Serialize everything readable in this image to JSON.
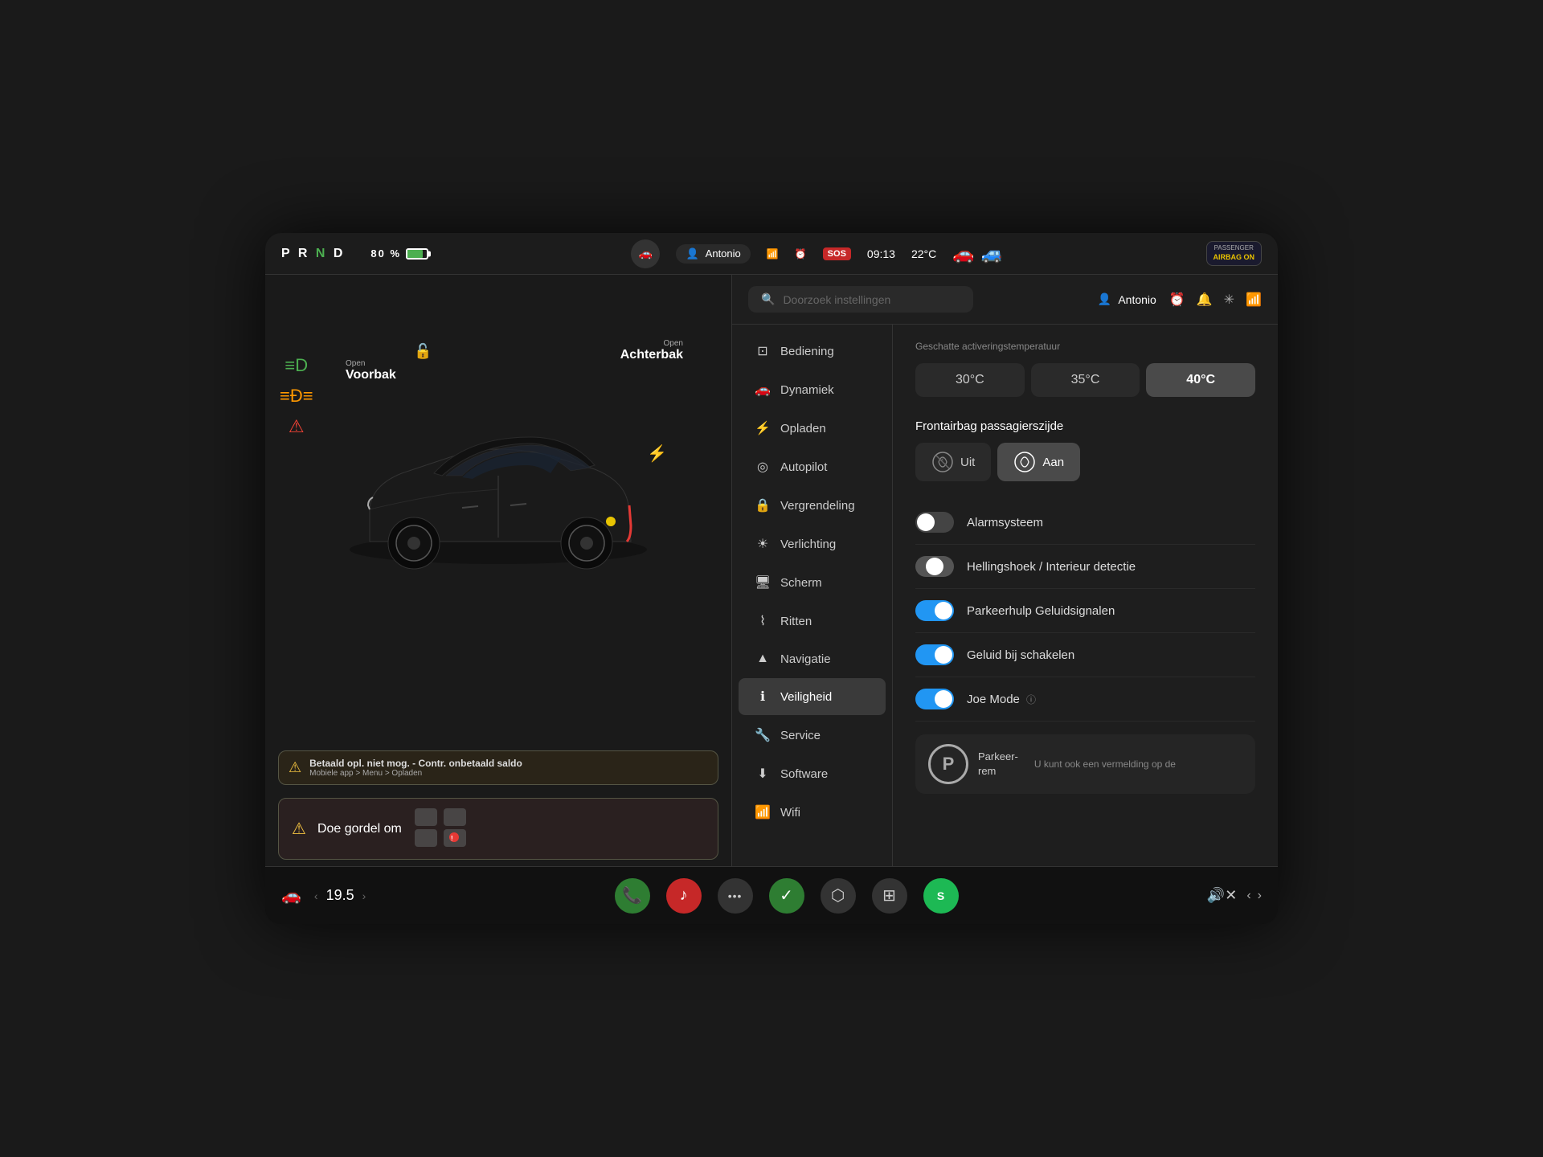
{
  "statusBar": {
    "prnd": "PRND",
    "battery_pct": "80 %",
    "user": "Antonio",
    "wifi_icon": "📶",
    "alarm_icon": "⏰",
    "sos": "SOS",
    "time": "09:13",
    "temperature": "22°C",
    "airbag_title": "PASSENGER",
    "airbag_sub": "AIRBAG ON"
  },
  "indicators": [
    {
      "icon": "≡D",
      "class": "green"
    },
    {
      "icon": "≡D≡",
      "class": "amber"
    },
    {
      "icon": "⚠",
      "class": "red"
    }
  ],
  "carLabels": {
    "voorbak_open": "Open",
    "voorbak": "Voorbak",
    "achterbak_open": "Open",
    "achterbak": "Achterbak"
  },
  "warningBanner": {
    "text": "Betaald opl. niet mog. - Contr. onbetaald saldo",
    "subtext": "Mobiele app > Menu > Opladen"
  },
  "seatbeltBanner": {
    "text": "Doe gordel om"
  },
  "settings": {
    "searchPlaceholder": "Doorzoek instellingen",
    "headerUser": "Antonio",
    "sectionTitle": "Geschatte activeringstemperatuur",
    "tempOptions": [
      "30°C",
      "35°C",
      "40°C"
    ],
    "tempActive": 2,
    "airbagTitle": "Frontairbag passagierszijde",
    "airbagOff": "Uit",
    "airbagOn": "Aan",
    "airbagActive": "on",
    "toggles": [
      {
        "label": "Alarmsysteem",
        "state": "off"
      },
      {
        "label": "Hellingshoek / Interieur detectie",
        "state": "mid"
      },
      {
        "label": "Parkeerhulp Geluidsignalen",
        "state": "on"
      },
      {
        "label": "Geluid bij schakelen",
        "state": "on"
      },
      {
        "label": "Joe Mode",
        "state": "on",
        "has_info": true
      }
    ]
  },
  "navItems": [
    {
      "icon": "⊡",
      "label": "Bediening"
    },
    {
      "icon": "🚗",
      "label": "Dynamiek"
    },
    {
      "icon": "⚡",
      "label": "Opladen"
    },
    {
      "icon": "◎",
      "label": "Autopilot"
    },
    {
      "icon": "🔒",
      "label": "Vergrendeling"
    },
    {
      "icon": "☀",
      "label": "Verlichting"
    },
    {
      "icon": "⬜",
      "label": "Scherm"
    },
    {
      "icon": "~",
      "label": "Ritten"
    },
    {
      "icon": "▲",
      "label": "Navigatie"
    },
    {
      "icon": "ℹ",
      "label": "Veiligheid",
      "active": true
    },
    {
      "icon": "🔧",
      "label": "Service"
    },
    {
      "icon": "⬇",
      "label": "Software"
    },
    {
      "icon": "📶",
      "label": "Wifi"
    }
  ],
  "parking": {
    "symbol": "P",
    "label": "Parkeer-\nrem",
    "subtext": "U kunt ook een vermelding op de"
  },
  "taskbar": {
    "temp": "19.5",
    "apps": [
      {
        "icon": "📞",
        "type": "phone"
      },
      {
        "icon": "♪",
        "type": "music"
      },
      {
        "icon": "•••",
        "type": "more"
      },
      {
        "icon": "✓",
        "type": "green-check"
      },
      {
        "icon": "⬡",
        "type": "bluetooth"
      },
      {
        "icon": "⊞",
        "type": "grid"
      },
      {
        "icon": "S",
        "type": "spotify",
        "badge": true
      }
    ],
    "volume_icon": "🔊",
    "volume_mute": "✕"
  }
}
